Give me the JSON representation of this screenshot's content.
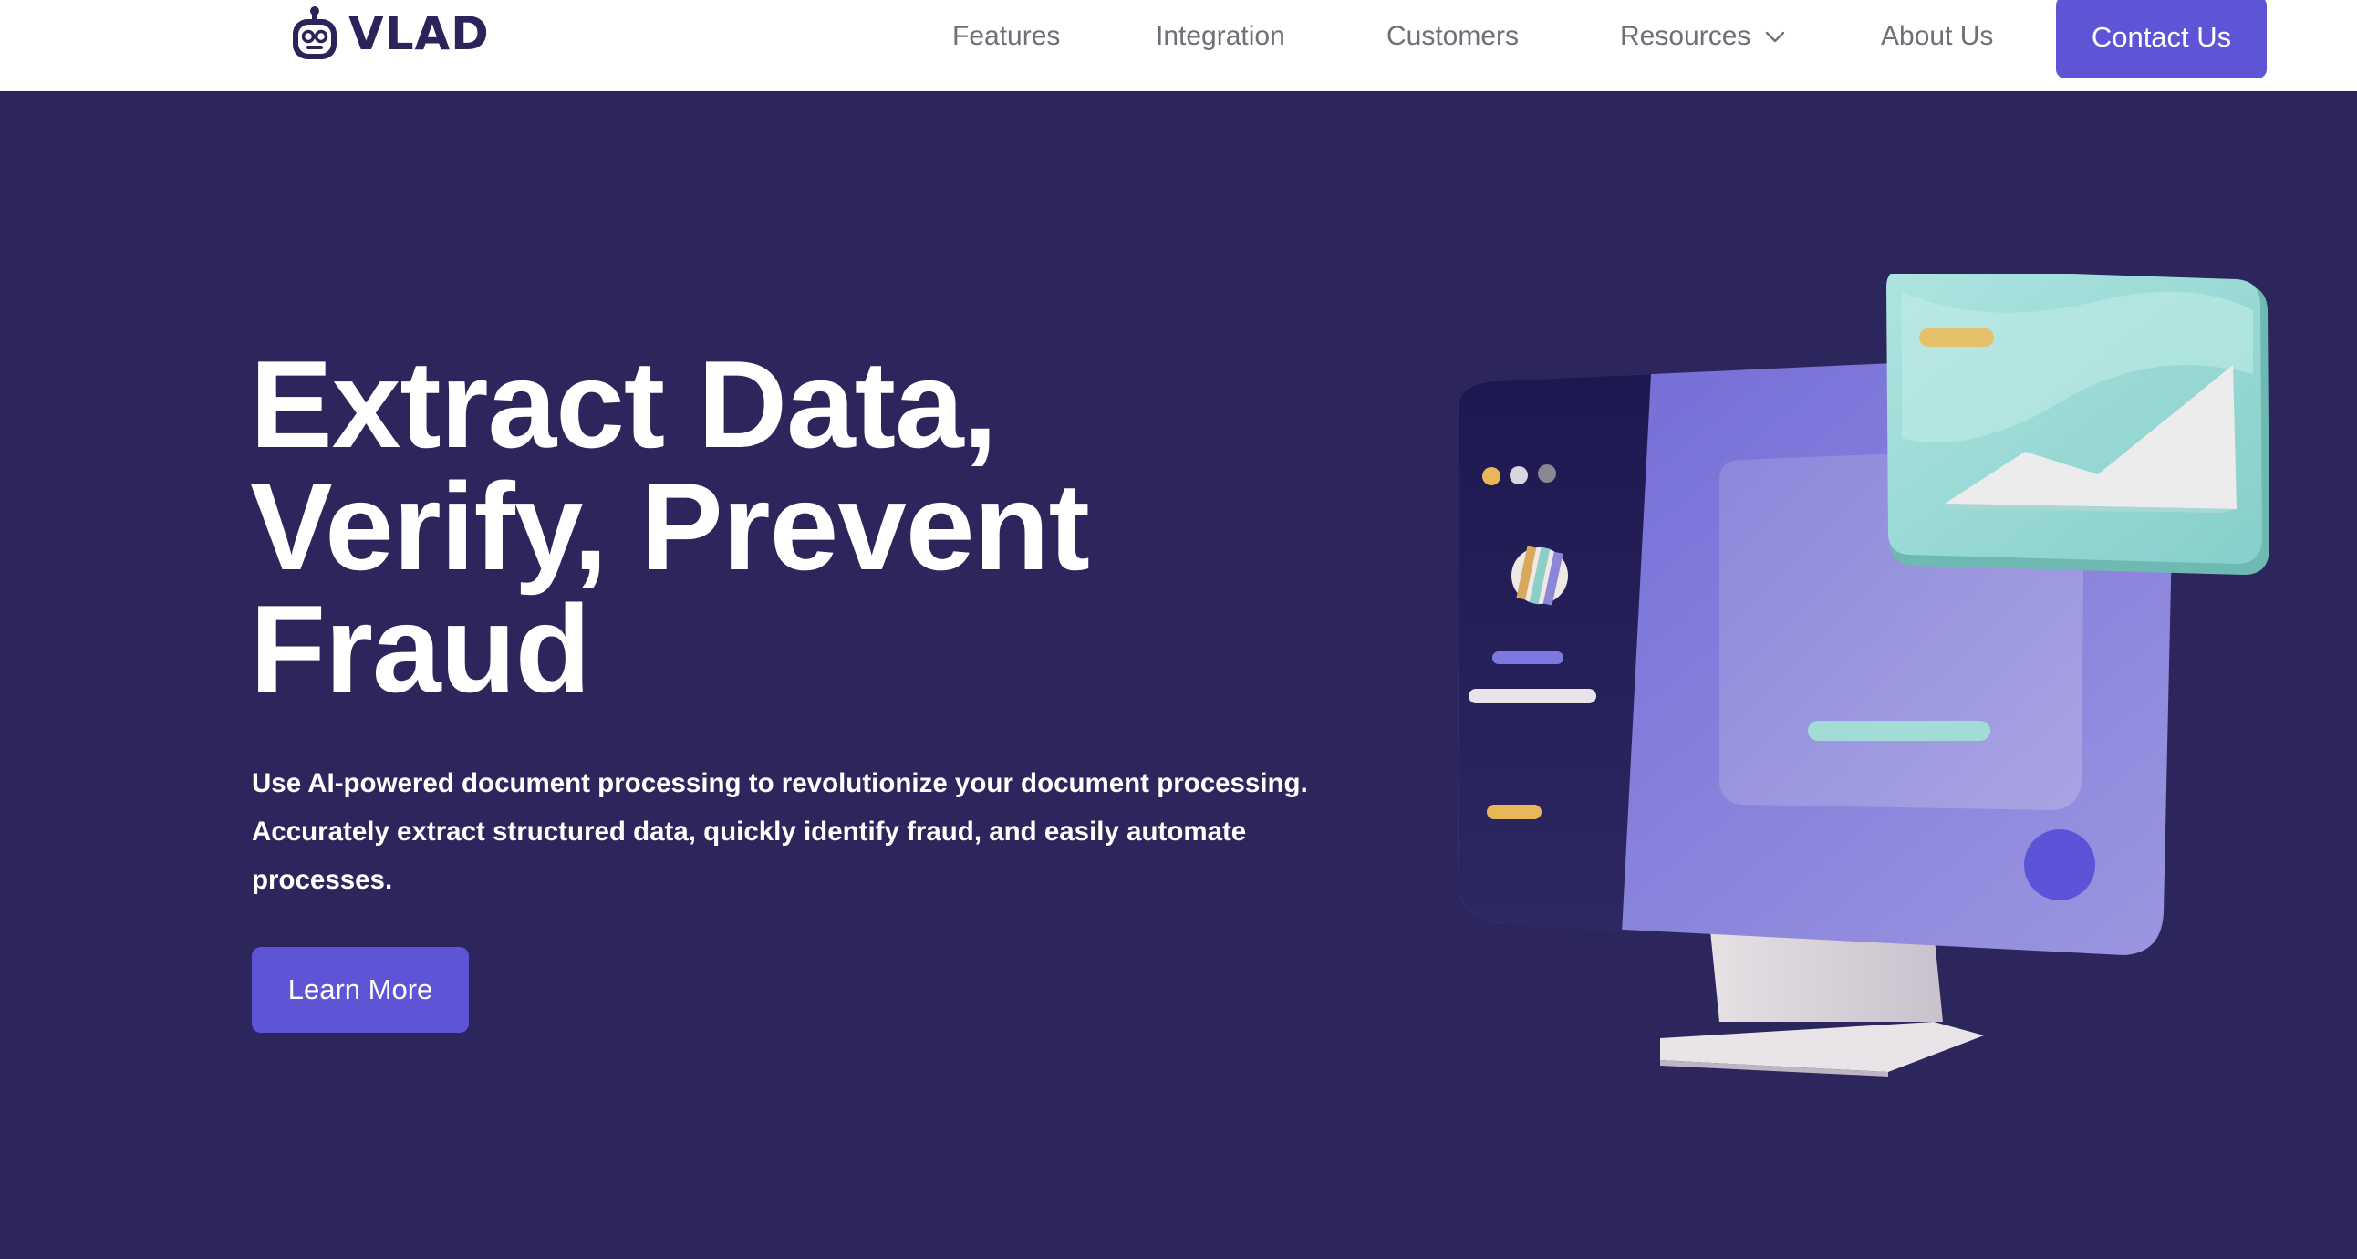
{
  "brand": {
    "name": "VLAD",
    "logo_icon": "robot-icon",
    "color": "#2a245a"
  },
  "nav": {
    "items": [
      {
        "label": "Features"
      },
      {
        "label": "Integration"
      },
      {
        "label": "Customers"
      },
      {
        "label": "Resources",
        "icon": "chevron-down-icon"
      },
      {
        "label": "About Us"
      }
    ],
    "cta_label": "Contact Us"
  },
  "hero": {
    "title_lines": [
      "Extract Data,",
      "Verify, Prevent",
      "Fraud"
    ],
    "description_lines": [
      "Use AI-powered document processing to revolutionize your document processing.",
      "Accurately extract structured data, quickly identify fraud, and easily automate",
      "processes."
    ],
    "button_label": "Learn More",
    "illustration": "monitor-illustration"
  },
  "colors": {
    "accent": "#5e55d6",
    "hero_background": "#2c265c",
    "nav_text": "#6f6f78",
    "header_background": "#ffffff"
  }
}
